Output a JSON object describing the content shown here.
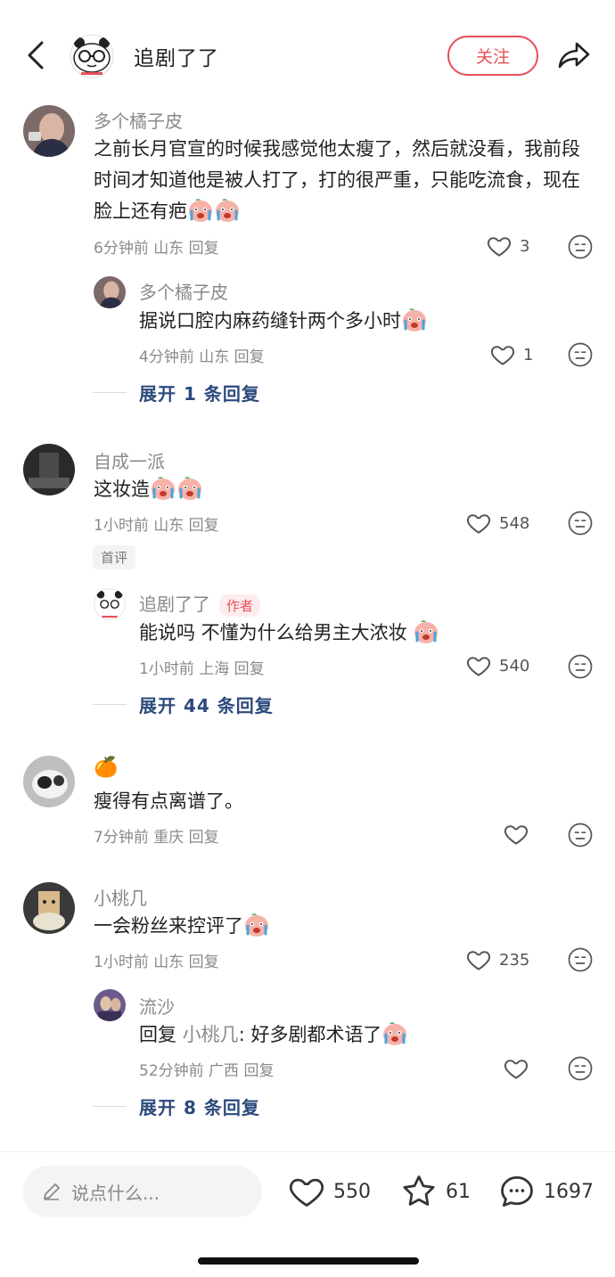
{
  "header": {
    "title": "追剧了了",
    "follow_label": "关注"
  },
  "comments": [
    {
      "user": "多个橘子皮",
      "text": "之前长月官宣的时候我感觉他太瘦了，然后就没看，我前段时间才知道他是被人打了，打的很严重，只能吃流食，现在脸上还有疤",
      "time": "6分钟前",
      "location": "山东",
      "reply_label": "回复",
      "likes": "3",
      "replies": [
        {
          "user": "多个橘子皮",
          "text": "据说口腔内麻药缝针两个多小时",
          "time": "4分钟前",
          "location": "山东",
          "reply_label": "回复",
          "likes": "1"
        }
      ],
      "expand_label": "展开 1 条回复"
    },
    {
      "user": "自成一派",
      "text": "这妆造",
      "time": "1小时前",
      "location": "山东",
      "reply_label": "回复",
      "likes": "548",
      "badge": "首评",
      "replies": [
        {
          "user": "追剧了了",
          "author_tag": "作者",
          "text": "能说吗  不懂为什么给男主大浓妆",
          "time": "1小时前",
          "location": "上海",
          "reply_label": "回复",
          "likes": "540"
        }
      ],
      "expand_label": "展开 44 条回复"
    },
    {
      "user": "🍊",
      "text": "瘦得有点离谱了。",
      "time": "7分钟前",
      "location": "重庆",
      "reply_label": "回复",
      "likes": ""
    },
    {
      "user": "小桃几",
      "text": "一会粉丝来控评了",
      "time": "1小时前",
      "location": "山东",
      "reply_label": "回复",
      "likes": "235",
      "replies": [
        {
          "user": "流沙",
          "reply_prefix": "回复",
          "reply_to": "小桃几",
          "text": ": 好多剧都术语了",
          "time": "52分钟前",
          "location": "广西",
          "reply_label": "回复",
          "likes": ""
        }
      ],
      "expand_label": "展开 8 条回复"
    }
  ],
  "bottom_bar": {
    "input_placeholder": "说点什么...",
    "likes": "550",
    "stars": "61",
    "comments": "1697"
  },
  "colors": {
    "accent": "#e8505b",
    "link": "#2c4a7c",
    "meta": "#8a8a8a"
  }
}
